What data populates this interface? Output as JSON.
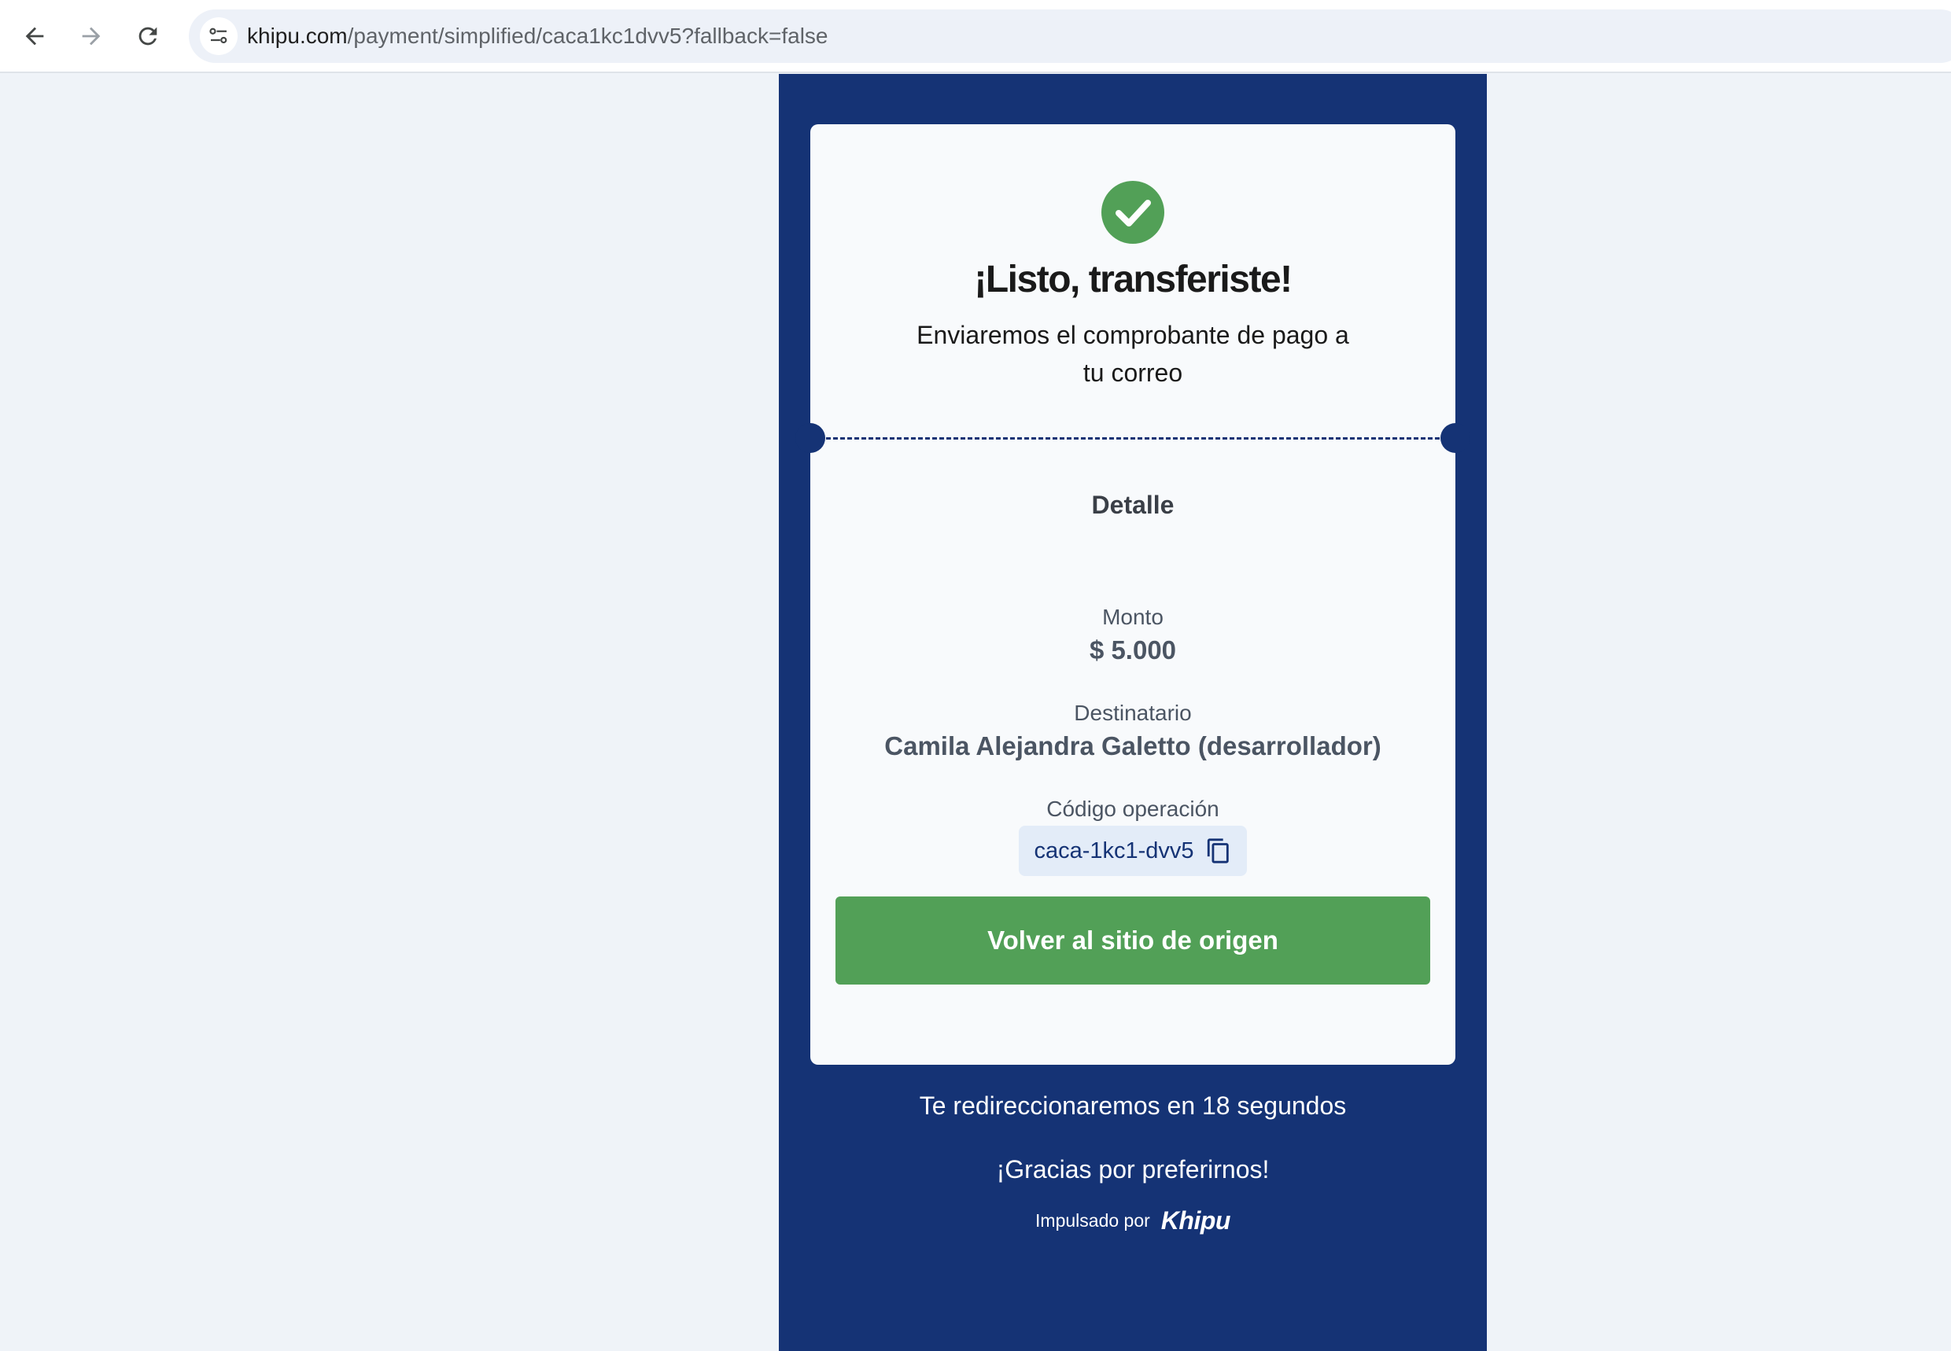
{
  "browser": {
    "url_host": "khipu.com",
    "url_path": "/payment/simplified/caca1kc1dvv5?fallback=false",
    "icons": [
      "back-arrow-icon",
      "forward-arrow-icon",
      "reload-icon",
      "site-settings-tune-icon"
    ]
  },
  "card": {
    "title": "¡Listo, transferiste!",
    "subtitle": "Enviaremos el comprobante de pago a tu correo",
    "detail_title": "Detalle",
    "amount_label": "Monto",
    "amount_value": "$ 5.000",
    "recipient_label": "Destinatario",
    "recipient_value": "Camila Alejandra Galetto (desarrollador)",
    "operation_label": "Código operación",
    "operation_code": "caca-1kc1-dvv5",
    "return_button": "Volver al sitio de origen"
  },
  "footer": {
    "redirect_text": "Te redireccionaremos en 18 segundos",
    "thanks_text": "¡Gracias por preferirnos!",
    "powered_by": "Impulsado por",
    "brand": "Khipu"
  },
  "colors": {
    "panel_bg": "#153375",
    "success_green": "#52a057",
    "card_bg": "#f8fafc",
    "page_bg": "#eff3f8"
  }
}
